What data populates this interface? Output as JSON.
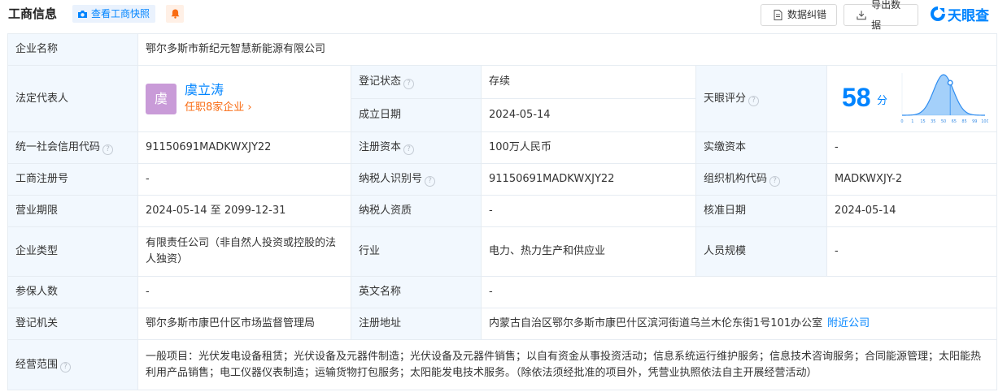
{
  "header": {
    "title": "工商信息",
    "snapshot_label": "查看工商快照",
    "correct_label": "数据纠错",
    "export_label": "导出数据",
    "logo_text": "天眼查"
  },
  "labels": {
    "company_name": "企业名称",
    "legal_rep": "法定代表人",
    "reg_status": "登记状态",
    "est_date": "成立日期",
    "tianyan_score": "天眼评分",
    "credit_code": "统一社会信用代码",
    "reg_capital": "注册资本",
    "paid_capital": "实缴资本",
    "reg_no": "工商注册号",
    "taxpayer_id": "纳税人识别号",
    "org_code": "组织机构代码",
    "biz_term": "营业期限",
    "taxpayer_qual": "纳税人资质",
    "approval_date": "核准日期",
    "company_type": "企业类型",
    "industry": "行业",
    "staff_size": "人员规模",
    "insured": "参保人数",
    "english_name": "英文名称",
    "reg_authority": "登记机关",
    "reg_address": "注册地址",
    "biz_scope": "经营范围"
  },
  "values": {
    "company_name": "鄂尔多斯市新纪元智慧新能源有限公司",
    "rep_avatar": "虞",
    "rep_name": "虞立涛",
    "rep_sub": "任职8家企业",
    "reg_status": "存续",
    "est_date": "2024-05-14",
    "score": "58",
    "score_unit": "分",
    "credit_code": "91150691MADKWXJY22",
    "reg_capital": "100万人民币",
    "paid_capital": "-",
    "reg_no": "-",
    "taxpayer_id": "91150691MADKWXJY22",
    "org_code": "MADKWXJY-2",
    "biz_term": "2024-05-14 至 2099-12-31",
    "taxpayer_qual": "-",
    "approval_date": "2024-05-14",
    "company_type": "有限责任公司（非自然人投资或控股的法人独资）",
    "industry": "电力、热力生产和供应业",
    "staff_size": "-",
    "insured": "-",
    "english_name": "-",
    "reg_authority": "鄂尔多斯市康巴什区市场监督管理局",
    "reg_address": "内蒙古自治区鄂尔多斯市康巴什区滨河街道乌兰木伦东街1号101办公室",
    "nearby_link": "附近公司",
    "biz_scope": "一般项目：光伏发电设备租赁；光伏设备及元器件制造；光伏设备及元器件销售；以自有资金从事投资活动；信息系统运行维护服务；信息技术咨询服务；合同能源管理；太阳能热利用产品销售；电工仪器仪表制造；运输货物打包服务；太阳能发电技术服务。（除依法须经批准的项目外，凭营业执照依法自主开展经营活动）"
  },
  "score_chart": {
    "ticks": [
      "0",
      "1",
      "15",
      "35",
      "50",
      "65",
      "85",
      "99",
      "100"
    ],
    "marker": 58
  },
  "colors": {
    "accent": "#0084ff",
    "label_bg": "#f2f8fe",
    "border": "#e6ecf2",
    "status_green": "#28a745",
    "orange": "#f96c13"
  }
}
